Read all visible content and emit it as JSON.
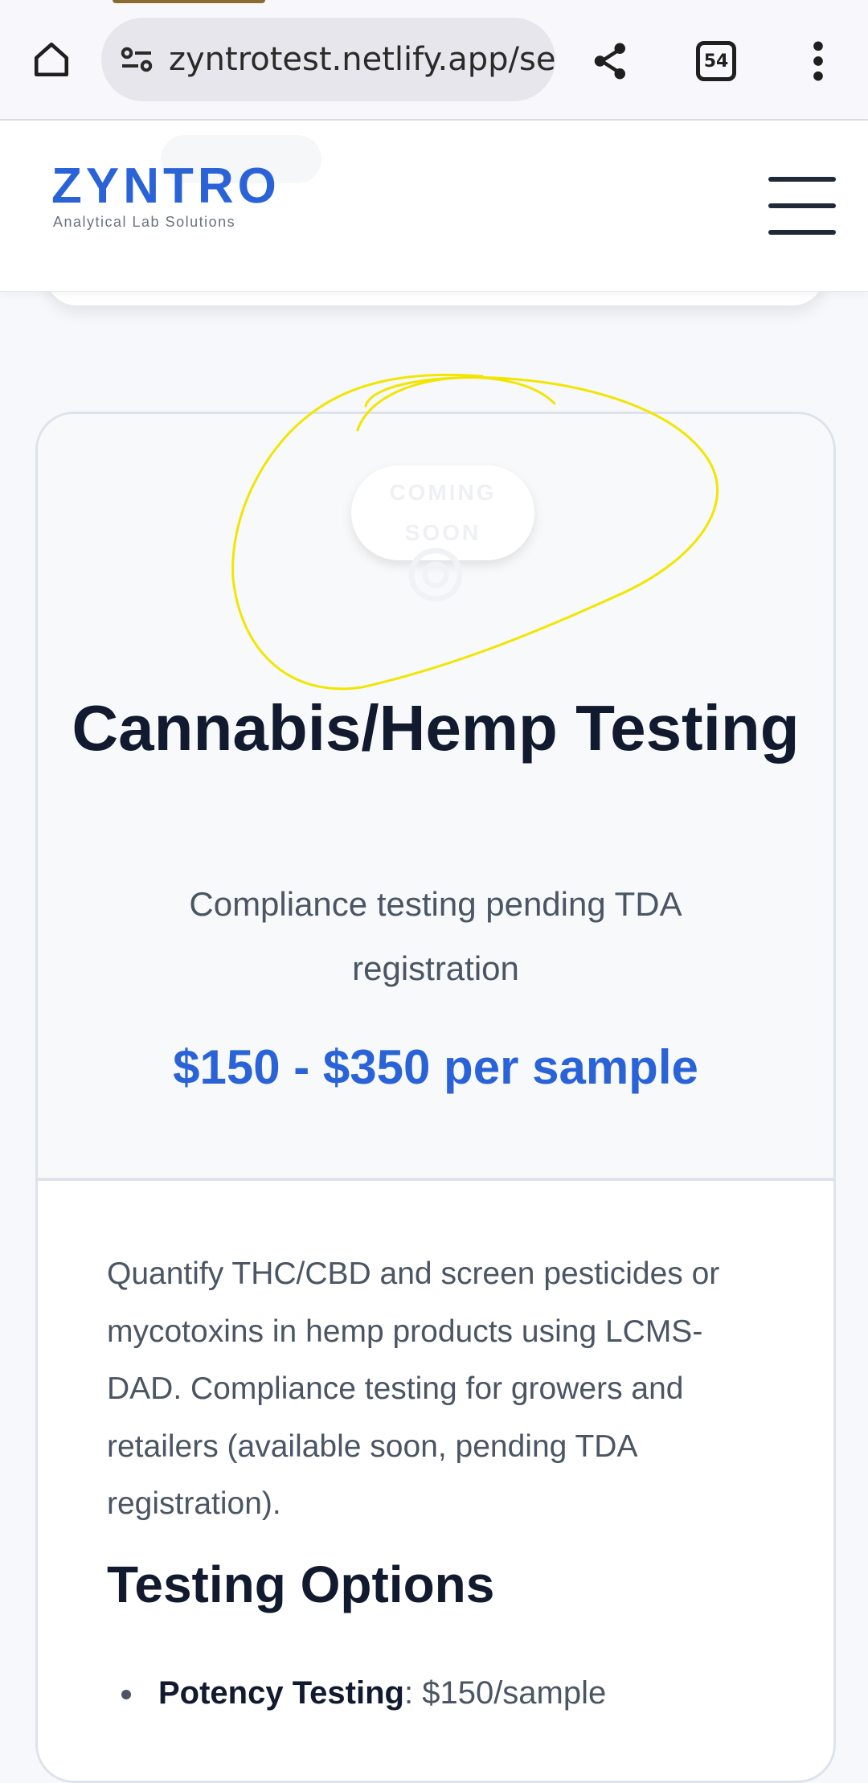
{
  "browser": {
    "url": "zyntrotest.netlify.app/se",
    "tab_count": "54"
  },
  "header": {
    "brand": "ZYNTRO",
    "tagline": "Analytical Lab Solutions"
  },
  "card": {
    "badge": "COMING SOON",
    "title": "Cannabis/Hemp Testing",
    "subtitle": "Compliance testing pending TDA registration",
    "price": "$150 - $350 per sample",
    "description": "Quantify THC/CBD and screen pesticides or mycotoxins in hemp products using LCMS-DAD. Compliance testing for growers and retailers (available soon, pending TDA registration).",
    "options_heading": "Testing Options",
    "options": [
      {
        "name": "Potency Testing",
        "price": ": $150/sample"
      }
    ]
  },
  "annotation": {
    "color": "#f2e600"
  }
}
